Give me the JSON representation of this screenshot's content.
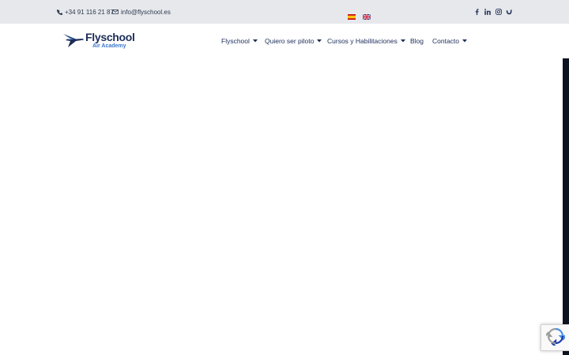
{
  "topbar": {
    "phone": "+34 91 116 21 87",
    "email": "info@flyschool.es",
    "languages": [
      {
        "code": "es",
        "icon": "spain-flag-icon"
      },
      {
        "code": "en",
        "icon": "uk-flag-icon"
      }
    ],
    "social": [
      "facebook-icon",
      "linkedin-icon",
      "instagram-icon",
      "other-social-icon"
    ]
  },
  "header": {
    "logo": {
      "title": "Flyschool",
      "subtitle": "Air Academy"
    },
    "nav": {
      "flyschool": "Flyschool",
      "piloto": "Quiero ser piloto",
      "cursos": "Cursos y Habilitaciones",
      "blog": "Blog",
      "contacto": "Contacto"
    }
  },
  "colors": {
    "topbar_bg": "#e6e8ec",
    "brand_navy": "#1c2d5a",
    "brand_blue": "#3a78c8",
    "side_strip": "#0d1320"
  }
}
